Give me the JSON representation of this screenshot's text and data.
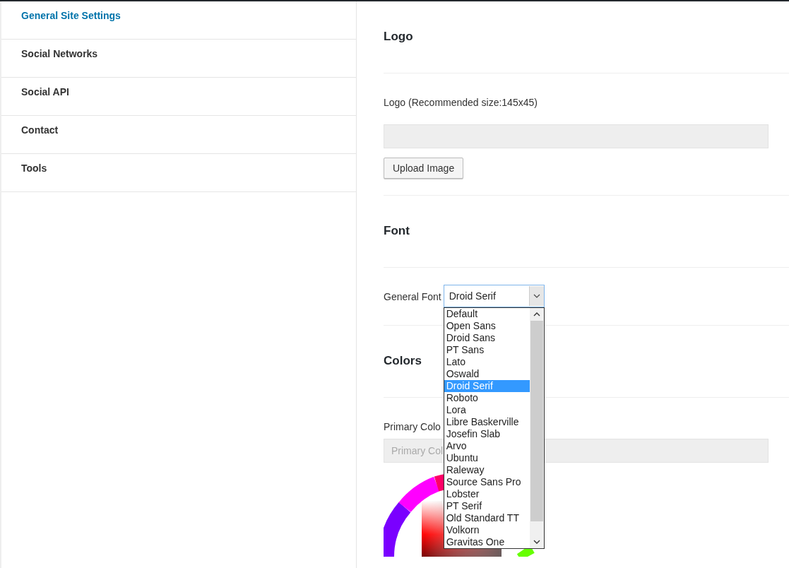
{
  "sidebar": {
    "items": [
      {
        "label": "General Site Settings",
        "selected": true
      },
      {
        "label": "Social Networks",
        "selected": false
      },
      {
        "label": "Social API",
        "selected": false
      },
      {
        "label": "Contact",
        "selected": false
      },
      {
        "label": "Tools",
        "selected": false
      }
    ]
  },
  "sections": [
    {
      "kind": "logo",
      "heading": "Logo",
      "label": "Logo (Recommended size:145x45)",
      "button": "Upload Image"
    },
    {
      "kind": "font",
      "heading": "Font",
      "label": "General Font",
      "select": {
        "value": "Droid Serif",
        "expanded": true,
        "options": [
          {
            "label": "Default",
            "selected": false
          },
          {
            "label": "Open Sans",
            "selected": false
          },
          {
            "label": "Droid Sans",
            "selected": false
          },
          {
            "label": "PT Sans",
            "selected": false
          },
          {
            "label": "Lato",
            "selected": false
          },
          {
            "label": "Oswald",
            "selected": false
          },
          {
            "label": "Droid Serif",
            "selected": true
          },
          {
            "label": "Roboto",
            "selected": false
          },
          {
            "label": "Lora",
            "selected": false
          },
          {
            "label": "Libre Baskerville",
            "selected": false
          },
          {
            "label": "Josefin Slab",
            "selected": false
          },
          {
            "label": "Arvo",
            "selected": false
          },
          {
            "label": "Ubuntu",
            "selected": false
          },
          {
            "label": "Raleway",
            "selected": false
          },
          {
            "label": "Source Sans Pro",
            "selected": false
          },
          {
            "label": "Lobster",
            "selected": false
          },
          {
            "label": "PT Serif",
            "selected": false
          },
          {
            "label": "Old Standard TT",
            "selected": false
          },
          {
            "label": "Volkorn",
            "selected": false
          },
          {
            "label": "Gravitas One",
            "selected": false
          }
        ]
      }
    },
    {
      "kind": "colors",
      "heading": "Colors",
      "label": "Primary Colo",
      "placeholder": "Primary Col"
    }
  ]
}
